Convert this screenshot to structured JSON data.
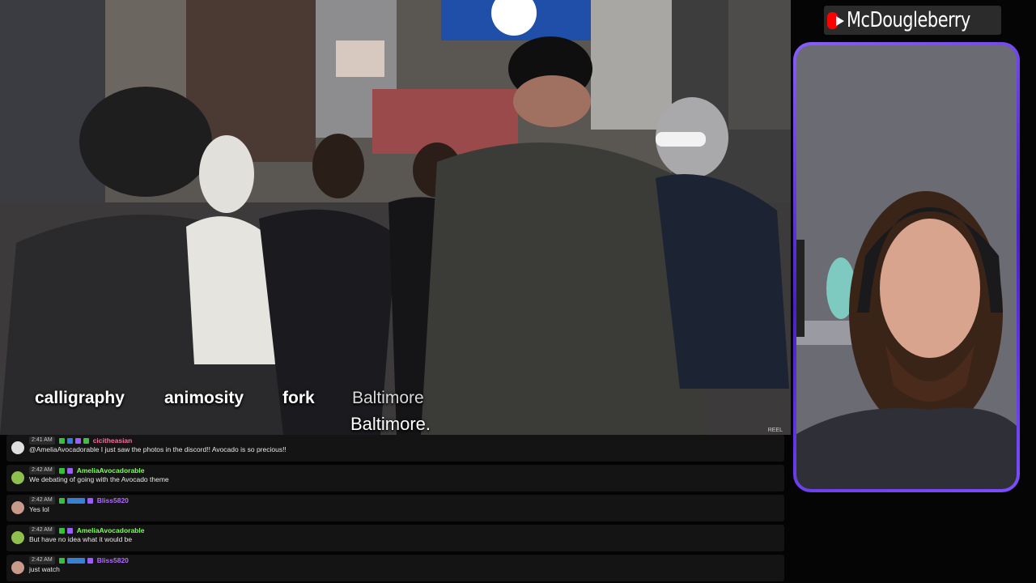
{
  "video": {
    "words": [
      "calligraphy",
      "animosity",
      "fork",
      "Baltimore"
    ],
    "subtitle": "Baltimore.",
    "watermark": "REEL"
  },
  "chat": {
    "messages": [
      {
        "time": "2:41 AM",
        "user": "cicitheasian",
        "user_color": "#ff6b9e",
        "text": "@AmeliaAvocadorable I just saw the photos in the discord!! Avocado is so precious!!"
      },
      {
        "time": "2:42 AM",
        "user": "AmeliaAvocadorable",
        "user_color": "#7dff5a",
        "text": "We debating of going with the Avocado theme"
      },
      {
        "time": "2:42 AM",
        "user": "Bliss5820",
        "user_color": "#b06cff",
        "text": "Yes lol"
      },
      {
        "time": "2:42 AM",
        "user": "AmeliaAvocadorable",
        "user_color": "#7dff5a",
        "text": "But have no idea what it would be"
      },
      {
        "time": "2:42 AM",
        "user": "Bliss5820",
        "user_color": "#b06cff",
        "text": "just watch"
      }
    ]
  },
  "channel": {
    "name": "McDougleberry",
    "icon": "youtube-logo-icon"
  },
  "colors": {
    "frame_accent": "#7c4dff",
    "youtube_red": "#ff0000"
  }
}
